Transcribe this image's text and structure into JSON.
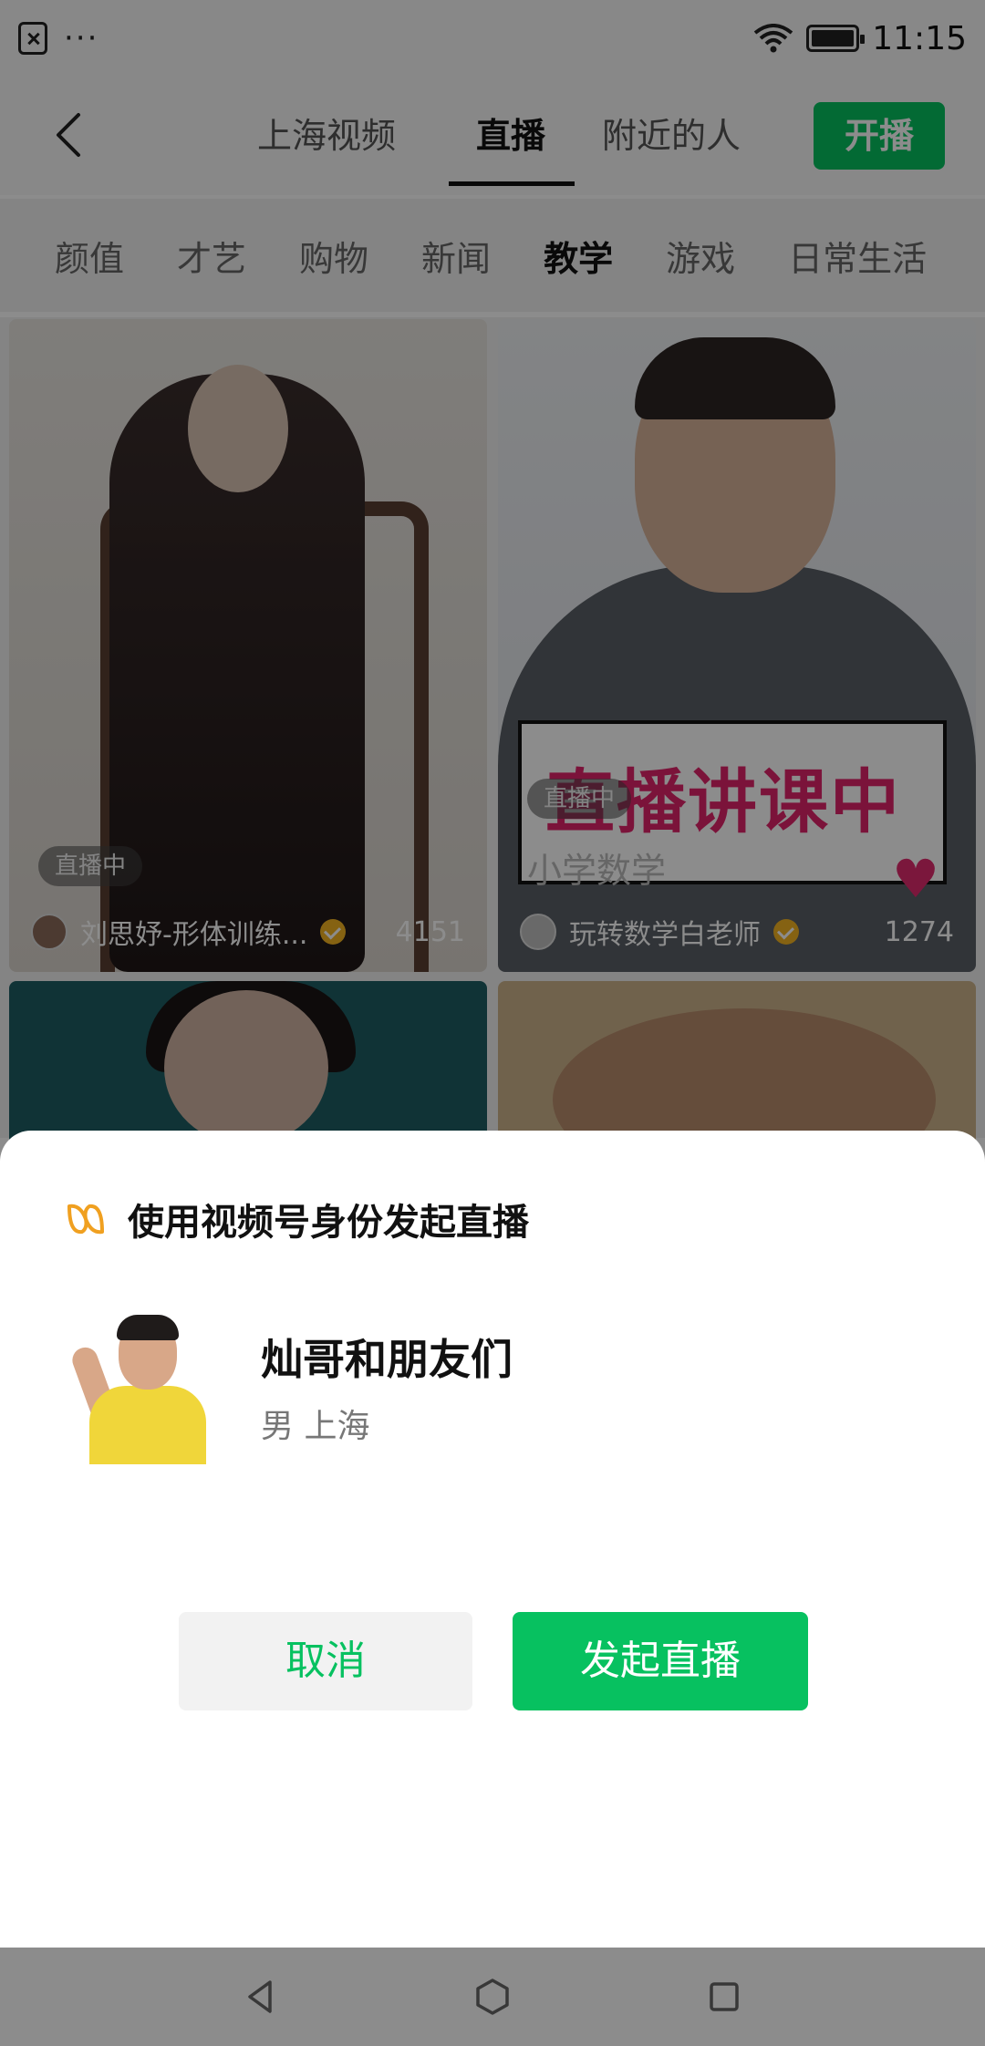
{
  "status_bar": {
    "time": "11:15",
    "more": "···"
  },
  "header": {
    "tabs": [
      "上海视频",
      "直播",
      "附近的人"
    ],
    "active_tab": "直播",
    "start_live_button": "开播"
  },
  "categories": [
    "颜值",
    "才艺",
    "购物",
    "新闻",
    "教学",
    "游戏",
    "日常生活"
  ],
  "active_category": "教学",
  "cards": [
    {
      "badge": "直播中",
      "name": "刘思妤-形体训练...",
      "count": "4151"
    },
    {
      "badge": "直播中",
      "name": "玩转数学白老师",
      "count": "1274",
      "banner": "直播讲课中",
      "banner_sub": "小学数学"
    }
  ],
  "sheet": {
    "title": "使用视频号身份发起直播",
    "profile_name": "灿哥和朋友们",
    "profile_sub": "男 上海",
    "cancel_button": "取消",
    "start_button": "发起直播"
  },
  "colors": {
    "accent": "#07c160",
    "badge_gold": "#f2b321",
    "banner_pink": "#e0246a"
  }
}
